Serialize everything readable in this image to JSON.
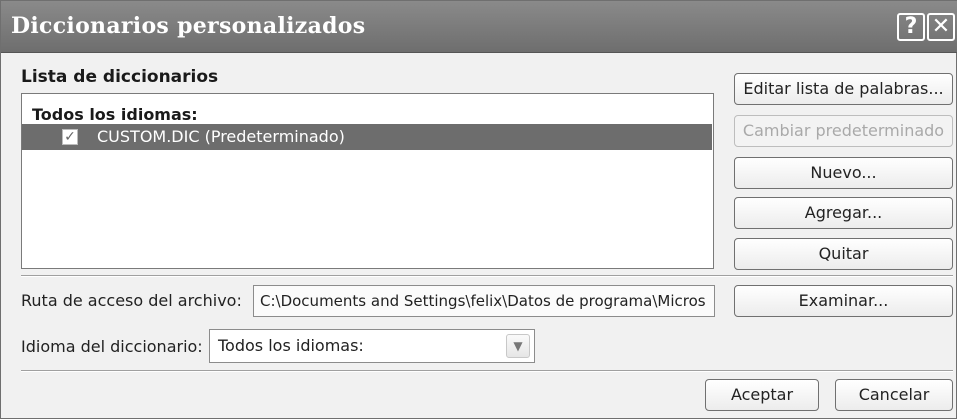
{
  "window": {
    "title": "Diccionarios personalizados",
    "help_glyph": "?",
    "close_glyph": "✕"
  },
  "dictionary_list": {
    "label": "Lista de diccionarios",
    "group_header": "Todos los idiomas:",
    "items": [
      {
        "label": "CUSTOM.DIC (Predeterminado)",
        "checked": true,
        "selected": true
      }
    ]
  },
  "buttons": {
    "edit_word_list": "Editar lista de palabras...",
    "change_default": "Cambiar predeterminado",
    "new": "Nuevo...",
    "add": "Agregar...",
    "remove": "Quitar",
    "browse": "Examinar...",
    "ok": "Aceptar",
    "cancel": "Cancelar"
  },
  "file_path": {
    "label": "Ruta de acceso del archivo:",
    "value": "C:\\Documents and Settings\\felix\\Datos de programa\\Micros"
  },
  "dictionary_language": {
    "label": "Idioma del diccionario:",
    "value": "Todos los idiomas:"
  },
  "colors": {
    "title_bar": "#7a7a7a",
    "selection": "#6d6d6d",
    "dialog_bg": "#f1f1f1"
  }
}
